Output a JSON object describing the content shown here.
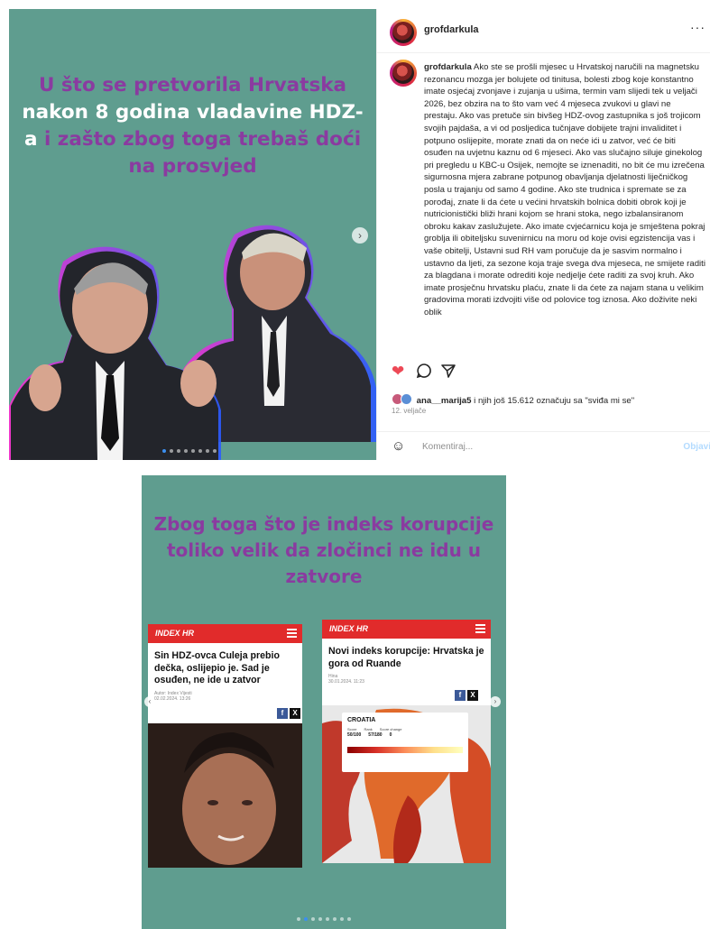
{
  "post": {
    "username": "grofdarkula",
    "slide1": {
      "headline_purple_1": "U što se pretvorila Hrvatska",
      "headline_white": "nakon 8 godina vladavine HDZ-a",
      "headline_purple_2": "i zašto zbog toga trebaš doći na prosvjed"
    },
    "caption": "Ako ste se prošli mjesec u Hrvatskoj naručili na magnetsku rezonancu mozga jer bolujete od tinitusa, bolesti zbog koje konstantno imate osjećaj zvonjave i zujanja u ušima, termin vam slijedi tek u veljači 2026, bez obzira na to što vam već 4 mjeseca zvukovi u glavi ne prestaju. Ako vas pretuče sin bivšeg HDZ-ovog zastupnika s još trojicom svojih pajdaša, a vi od posljedica tučnjave dobijete trajni invaliditet i potpuno oslijepite, morate znati da on neće ići u zatvor, već će biti osuđen na uvjetnu kaznu od 6 mjeseci. Ako vas slučajno siluje ginekolog pri pregledu u KBC-u Osijek, nemojte se iznenaditi, no bit će mu izrečena sigurnosna mjera zabrane potpunog obavljanja djelatnosti liječničkog posla u trajanju od samo 4 godine. Ako ste trudnica i spremate se za porođaj, znate li da ćete u većini hrvatskih bolnica dobiti obrok koji je nutricionistički bliži hrani kojom se hrani stoka, nego izbalansiranom obroku kakav zaslužujete. Ako imate cvjećarnicu koja je smještena pokraj groblja ili obiteljsku suvenirnicu na moru od koje ovisi egzistencija vas i vaše obitelji, Ustavni sud RH vam poručuje da je sasvim normalno i ustavno da ljeti, za sezone koja traje svega dva mjeseca, ne smijete raditi za blagdana i morate odrediti koje nedjelje ćete raditi za svoj kruh. Ako imate prosječnu hrvatsku plaću, znate li da ćete za najam stana u velikim gradovima morati izdvojiti više od polovice tog iznosa. Ako doživite neki oblik",
    "likes": {
      "user": "ana__marija5",
      "text": " i njih još 15.612 označuju sa \"sviđa mi se\""
    },
    "date": "12. veljače",
    "comment_placeholder": "Komentiraj...",
    "post_button": "Objavi",
    "icons": [
      "heart-icon",
      "comment-icon",
      "share-icon",
      "bookmark-icon",
      "smile-icon",
      "more-icon",
      "next-arrow-icon"
    ],
    "colors": {
      "slide_bg": "#5f9d8f",
      "purple": "#8a3ba0",
      "heart": "#ed4956",
      "index_red": "#e12b2b"
    }
  },
  "slide2": {
    "headline": "Zbog toga što je indeks korupcije toliko velik da zločinci ne idu u zatvore",
    "card1": {
      "logo": "INDEX HR",
      "title": "Sin HDZ-ovca Culeja prebio dečka, oslijepio je. Sad je osuđen, ne ide u zatvor",
      "meta_author": "Autor: Index Vijesti",
      "meta_date": "02.02.2024. 13:26"
    },
    "card2": {
      "logo": "INDEX HR",
      "title": "Novi indeks korupcije: Hrvatska je gora od Ruande",
      "meta_author": "Hina",
      "meta_date": "30.01.2024. 11:23",
      "map_country": "CROATIA",
      "map_labels": [
        "Score",
        "Rank",
        "Score change"
      ],
      "map_values": [
        "50/100",
        "57/180",
        "0"
      ]
    }
  }
}
